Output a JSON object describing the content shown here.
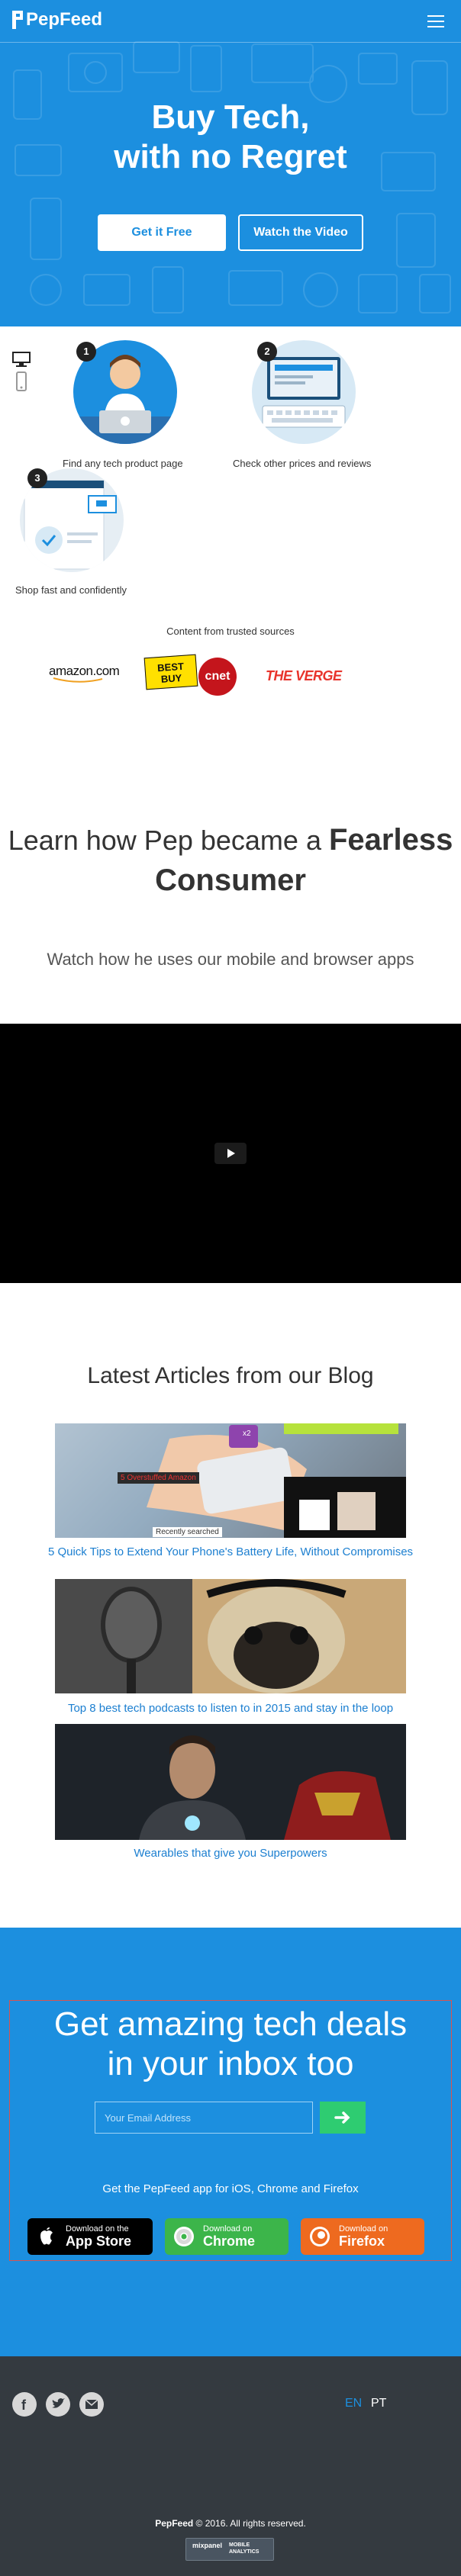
{
  "header": {
    "logo_text": "PepFeed",
    "menu_icon": "hamburger-menu-icon"
  },
  "hero": {
    "title_line1": "Buy Tech,",
    "title_line2": "with no Regret",
    "primary_button": "Get it Free",
    "secondary_button": "Watch the Video"
  },
  "how_it_works": {
    "steps": [
      {
        "number": "1",
        "label": "Find any tech product page"
      },
      {
        "number": "2",
        "label": "Check other prices and reviews"
      },
      {
        "number": "3",
        "label": "Shop fast and confidently"
      }
    ],
    "device_icons": [
      "desktop-icon",
      "mobile-icon"
    ]
  },
  "trusted": {
    "title": "Content from trusted sources",
    "brands": [
      "amazon.com",
      "BEST BUY",
      "cnet",
      "THE VERGE"
    ]
  },
  "learn": {
    "title_part1": "Learn how Pep became a ",
    "title_bold_line1": "Fearless",
    "title_bold_line2": "Consumer",
    "subtitle": "Watch how he uses our mobile and browser apps"
  },
  "blog": {
    "title": "Latest Articles from our Blog",
    "articles": [
      {
        "title": "5 Quick Tips to Extend Your Phone's Battery Life, Without Compromises",
        "image_labels": [
          "5 Overstuffed Amazon",
          "Recently searched",
          "x2"
        ]
      },
      {
        "title": "Top 8 best tech podcasts to listen to in 2015 and stay in the loop"
      },
      {
        "title": "Wearables that give you Superpowers"
      }
    ]
  },
  "newsletter": {
    "title_line1": "Get amazing tech deals",
    "title_line2": "in your inbox too",
    "email_placeholder": "Your Email Address",
    "app_line": "Get the PepFeed app for iOS, Chrome and Firefox",
    "stores": [
      {
        "small": "Download on the",
        "big": "App Store",
        "color": "#000000"
      },
      {
        "small": "Download on",
        "big": "Chrome",
        "color": "#3cb54a"
      },
      {
        "small": "Download on",
        "big": "Firefox",
        "color": "#ee6a1f"
      }
    ]
  },
  "footer": {
    "social": [
      "facebook-icon",
      "twitter-icon",
      "mail-icon"
    ],
    "languages": [
      "EN",
      "PT"
    ],
    "active_language": "EN",
    "brand": "PepFeed",
    "copyright_rest": " © 2016. All rights reserved.",
    "mixpanel_name": "mixpanel",
    "mixpanel_sub": "MOBILE ANALYTICS"
  },
  "colors": {
    "brand_blue": "#1c8fdf",
    "link_blue": "#1c7fd0",
    "footer_bg": "#343a40",
    "email_button": "#2ecc71"
  }
}
